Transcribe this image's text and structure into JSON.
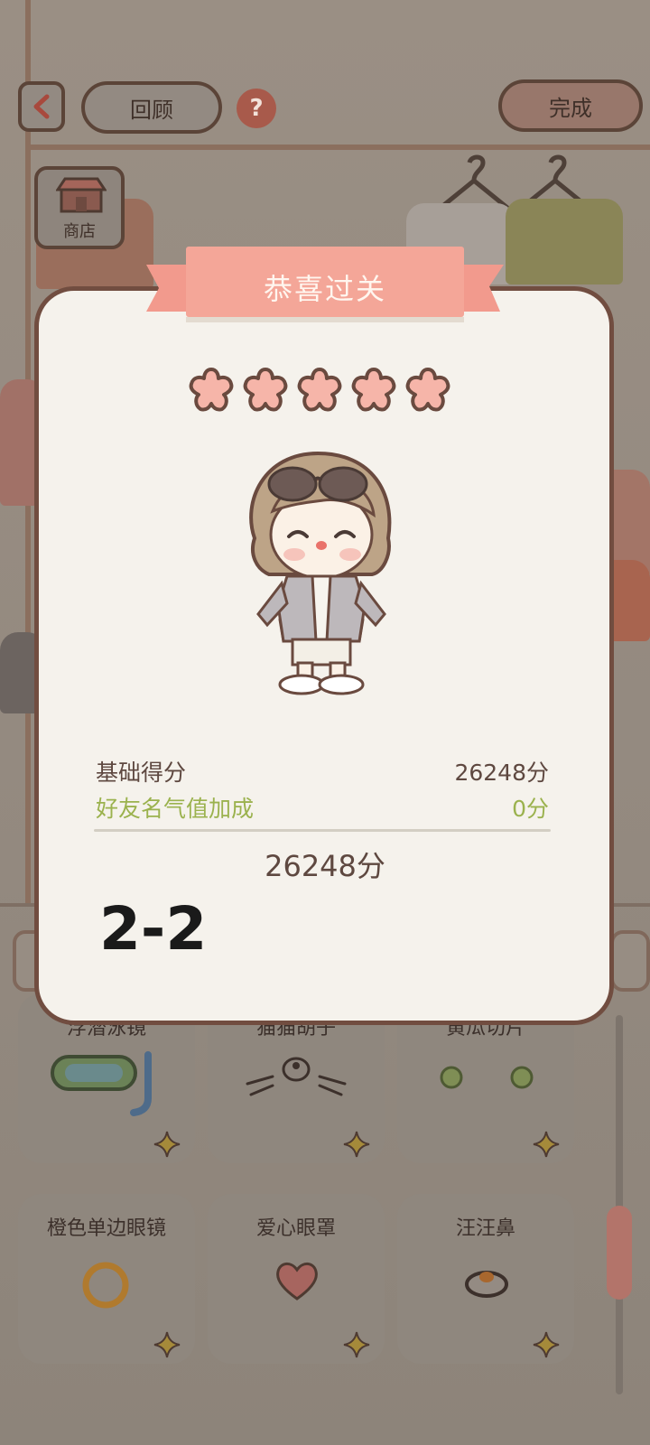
{
  "header": {
    "back_icon": "chevron-left-icon",
    "review_label": "回顾",
    "help_icon": "question-mark-icon",
    "done_label": "完成",
    "shop_label": "商店"
  },
  "dialog": {
    "title": "恭喜过关",
    "stars": 5,
    "star_max": 5,
    "base_score_label": "基础得分",
    "base_score_value": "26248分",
    "bonus_label": "好友名气值加成",
    "bonus_value": "0分",
    "total_score": "26248分",
    "level": "2-2"
  },
  "items": [
    {
      "name": "浮潜泳镜"
    },
    {
      "name": "猫猫胡子"
    },
    {
      "name": "黄瓜切片"
    },
    {
      "name": "橙色单边眼镜"
    },
    {
      "name": "爱心眼罩"
    },
    {
      "name": "汪汪鼻"
    }
  ],
  "colors": {
    "accent": "#f4a698",
    "dialog_border": "#714d40",
    "bonus_green": "#9bb24e",
    "text_brown": "#5e4840"
  }
}
